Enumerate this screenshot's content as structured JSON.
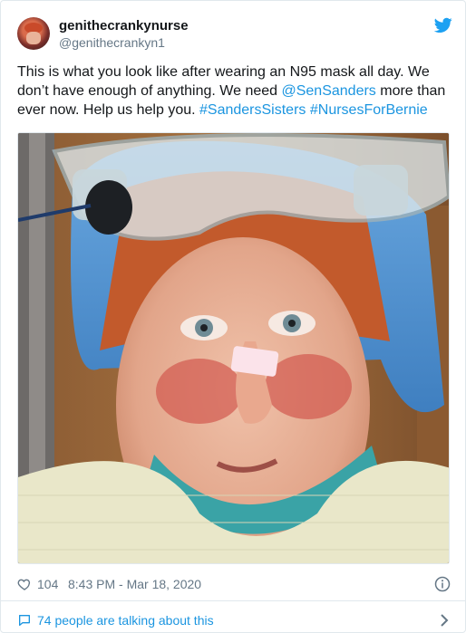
{
  "tweet": {
    "author": {
      "display_name": "genithecrankynurse",
      "handle": "@genithecrankyn1"
    },
    "text": {
      "part1": "This is what you look like after wearing an N95 mask all day. We don’t have enough of anything. We need ",
      "mention": "@SenSanders",
      "part2": " more than ever now. Help us help you. ",
      "hashtag1": "#SandersSisters",
      "space": " ",
      "hashtag2": "#NursesForBernie"
    },
    "likes": "104",
    "timestamp": "8:43 PM - Mar 18, 2020",
    "talking": "74 people are talking about this"
  },
  "icons": {
    "brand": "twitter-bird-icon",
    "like": "heart-icon",
    "info": "info-icon",
    "talking": "comment-bubble-icon",
    "chevron": "chevron-right-icon"
  },
  "colors": {
    "link": "#1b95e0",
    "secondary_text": "#657786",
    "border": "#e1e8ed",
    "twitter_blue": "#1da1f2"
  }
}
